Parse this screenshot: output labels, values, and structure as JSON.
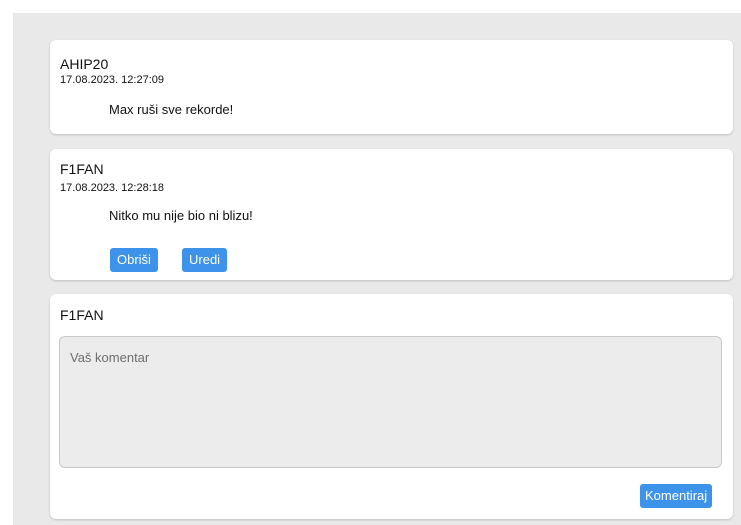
{
  "comments": [
    {
      "username": "AHIP20",
      "date": "17.08.2023. 12:27:09",
      "text": "Max ruši sve rekorde!"
    },
    {
      "username": "F1FAN",
      "date": "17.08.2023. 12:28:18",
      "text": "Nitko mu nije bio ni blizu!",
      "delete_label": "Obriši",
      "edit_label": "Uredi"
    }
  ],
  "new_comment": {
    "username": "F1FAN",
    "placeholder": "Vaš komentar",
    "submit_label": "Komentiraj"
  },
  "colors": {
    "button": "#3d93ea",
    "panel_bg": "#e9e9e9",
    "card_bg": "#ffffff"
  }
}
